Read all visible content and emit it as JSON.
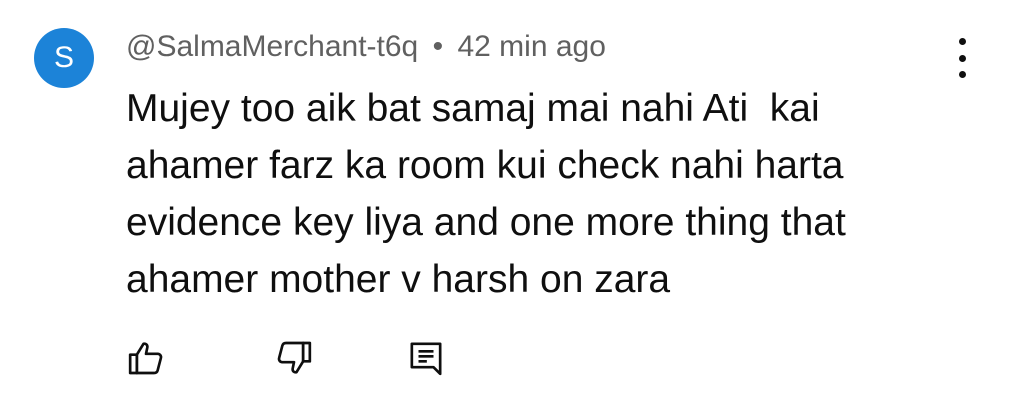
{
  "comment": {
    "avatar_letter": "S",
    "avatar_color": "#1c83d8",
    "username": "@SalmaMerchant-t6q",
    "separator": "•",
    "timestamp": "42 min ago",
    "text_lines": [
      "Mujey too aik bat samaj mai nahi Ati  kai",
      "ahamer farz ka room kui check nahi harta",
      "evidence key liya and one more thing that",
      "ahamer mother v harsh on zara"
    ],
    "actions": {
      "like_icon": "thumb-up-icon",
      "dislike_icon": "thumb-down-icon",
      "reply_icon": "comment-icon"
    },
    "menu_icon": "more-vertical-icon"
  }
}
